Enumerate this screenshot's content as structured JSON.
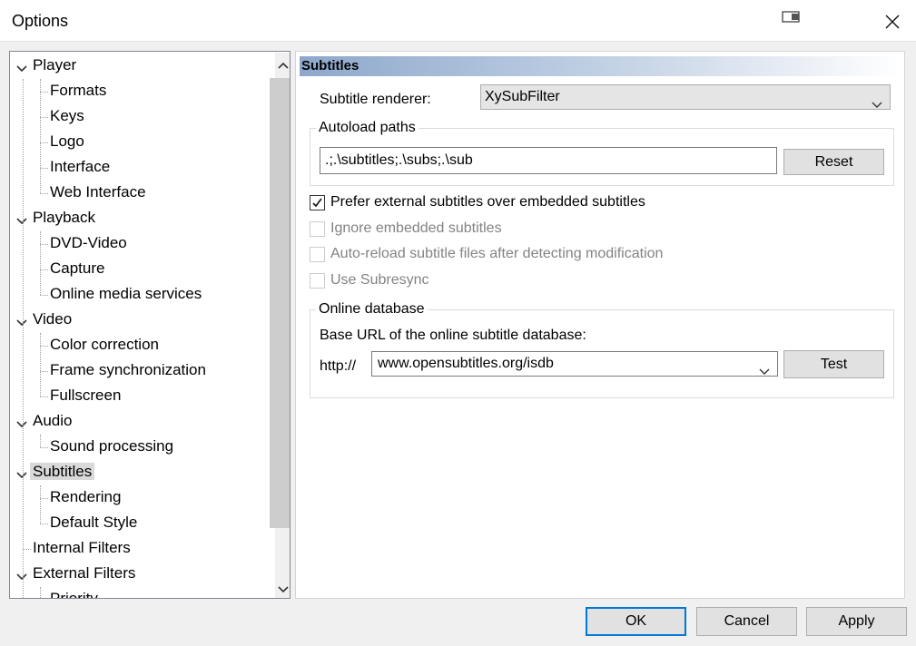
{
  "window": {
    "title": "Options"
  },
  "tree": [
    {
      "label": "Player",
      "level": 0,
      "expanded": true
    },
    {
      "label": "Formats",
      "level": 1
    },
    {
      "label": "Keys",
      "level": 1
    },
    {
      "label": "Logo",
      "level": 1
    },
    {
      "label": "Interface",
      "level": 1
    },
    {
      "label": "Web Interface",
      "level": 1
    },
    {
      "label": "Playback",
      "level": 0,
      "expanded": true
    },
    {
      "label": "DVD-Video",
      "level": 1
    },
    {
      "label": "Capture",
      "level": 1
    },
    {
      "label": "Online media services",
      "level": 1
    },
    {
      "label": "Video",
      "level": 0,
      "expanded": true
    },
    {
      "label": "Color correction",
      "level": 1
    },
    {
      "label": "Frame synchronization",
      "level": 1
    },
    {
      "label": "Fullscreen",
      "level": 1
    },
    {
      "label": "Audio",
      "level": 0,
      "expanded": true
    },
    {
      "label": "Sound processing",
      "level": 1
    },
    {
      "label": "Subtitles",
      "level": 0,
      "expanded": true,
      "selected": true
    },
    {
      "label": "Rendering",
      "level": 1
    },
    {
      "label": "Default Style",
      "level": 1
    },
    {
      "label": "Internal Filters",
      "level": 0
    },
    {
      "label": "External Filters",
      "level": 0,
      "expanded": true
    },
    {
      "label": "Priority",
      "level": 1
    }
  ],
  "page": {
    "header": "Subtitles",
    "renderer_label": "Subtitle renderer:",
    "renderer_value": "XySubFilter",
    "autoload": {
      "group_title": "Autoload paths",
      "value": ".;.\\subtitles;.\\subs;.\\sub",
      "reset_label": "Reset"
    },
    "options": [
      {
        "label": "Prefer external subtitles over embedded subtitles",
        "checked": true,
        "enabled": true
      },
      {
        "label": "Ignore embedded subtitles",
        "checked": false,
        "enabled": false
      },
      {
        "label": "Auto-reload subtitle files after detecting modification",
        "checked": false,
        "enabled": false
      },
      {
        "label": "Use Subresync",
        "checked": false,
        "enabled": false
      }
    ],
    "online": {
      "group_title": "Online database",
      "base_url_label": "Base URL of the online subtitle database:",
      "prefix": "http://",
      "url_value": "www.opensubtitles.org/isdb",
      "test_label": "Test"
    }
  },
  "buttons": {
    "ok": "OK",
    "cancel": "Cancel",
    "apply": "Apply"
  },
  "colors": {
    "accent": "#0078d7",
    "header_gradient_start": "#8da8cc",
    "selected_bg": "#d9d9d9"
  }
}
